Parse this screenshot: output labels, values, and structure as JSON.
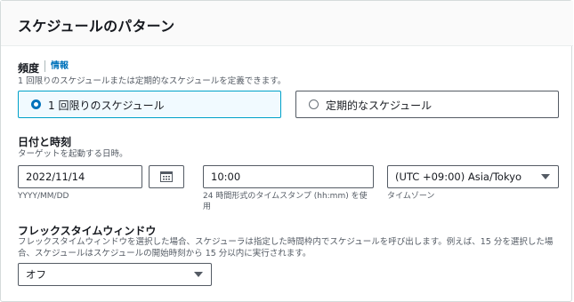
{
  "section": {
    "title": "スケジュールのパターン"
  },
  "frequency": {
    "label": "頻度",
    "info_link": "情報",
    "description": "1 回限りのスケジュールまたは定期的なスケジュールを定義できます。",
    "options": [
      {
        "label": "1 回限りのスケジュール",
        "selected": true
      },
      {
        "label": "定期的なスケジュール",
        "selected": false
      }
    ]
  },
  "date_time": {
    "label": "日付と時刻",
    "description": "ターゲットを起動する日時。",
    "date": {
      "value": "2022/11/14",
      "hint": "YYYY/MM/DD"
    },
    "calendar_icon": "calendar-icon",
    "time": {
      "value": "10:00",
      "hint": "24 時間形式のタイムスタンプ (hh:mm) を使用"
    },
    "timezone": {
      "value": "(UTC +09:00) Asia/Tokyo",
      "hint": "タイムゾーン"
    }
  },
  "flex_window": {
    "label": "フレックスタイムウィンドウ",
    "description": "フレックスタイムウィンドウを選択した場合、スケジューラは指定した時間枠内でスケジュールを呼び出します。例えば、15 分を選択した場合、スケジュールはスケジュールの開始時刻から 15 分以内に実行されます。",
    "value": "オフ"
  },
  "colors": {
    "accent": "#0073bb",
    "selected_bg": "#f1faff",
    "selected_border": "#00a1c9",
    "text": "#16191f",
    "muted": "#545b64"
  }
}
